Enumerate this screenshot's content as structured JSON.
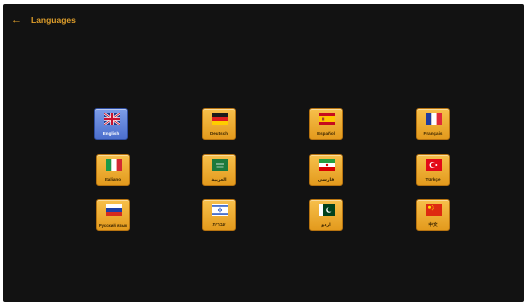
{
  "header": {
    "back_icon": "arrow-left-icon",
    "title": "Languages"
  },
  "colors": {
    "background": "#121212",
    "accent": "#e3a12b",
    "tile": "#f2b436",
    "tile_selected": "#5a7ed8"
  },
  "languages": [
    {
      "label": "English",
      "flag": "uk-flag-icon",
      "selected": true
    },
    {
      "label": "Deutsch",
      "flag": "germany-flag-icon",
      "selected": false
    },
    {
      "label": "Español",
      "flag": "spain-flag-icon",
      "selected": false
    },
    {
      "label": "Français",
      "flag": "france-flag-icon",
      "selected": false
    },
    {
      "label": "Italiano",
      "flag": "italy-flag-icon",
      "selected": false
    },
    {
      "label": "العربية",
      "flag": "saudi-arabia-flag-icon",
      "selected": false
    },
    {
      "label": "فارسی",
      "flag": "iran-flag-icon",
      "selected": false
    },
    {
      "label": "Türkçe",
      "flag": "turkey-flag-icon",
      "selected": false
    },
    {
      "label": "Русский язык",
      "flag": "russia-flag-icon",
      "selected": false
    },
    {
      "label": "עברית",
      "flag": "israel-flag-icon",
      "selected": false
    },
    {
      "label": "اردو",
      "flag": "pakistan-flag-icon",
      "selected": false
    },
    {
      "label": "中文",
      "flag": "china-flag-icon",
      "selected": false
    }
  ]
}
